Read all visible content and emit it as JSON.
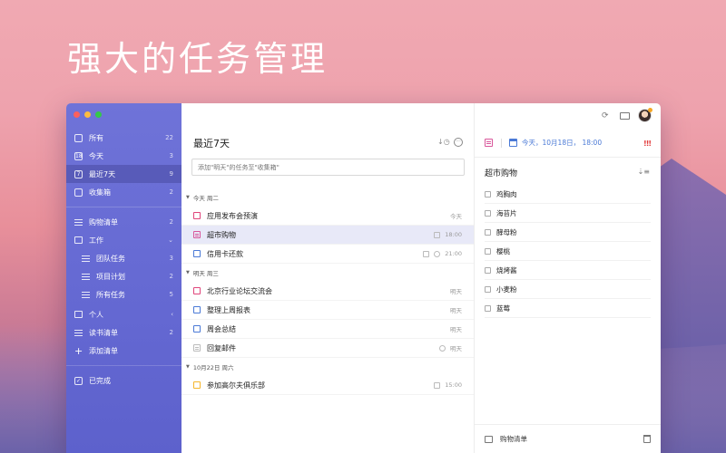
{
  "headline": "强大的任务管理",
  "sidebar": {
    "items": [
      {
        "label": "所有",
        "count": "22",
        "icon": "calendar-icon"
      },
      {
        "label": "今天",
        "count": "3",
        "icon": "today-icon"
      },
      {
        "label": "最近7天",
        "count": "9",
        "icon": "week-icon"
      },
      {
        "label": "收集箱",
        "count": "2",
        "icon": "inbox-icon"
      }
    ],
    "lists": [
      {
        "label": "购物清单",
        "count": "2",
        "icon": "list-icon"
      },
      {
        "label": "工作",
        "count": "",
        "icon": "folder-icon",
        "indicator": "⌄"
      },
      {
        "label": "团队任务",
        "count": "3",
        "icon": "list-icon",
        "sub": true
      },
      {
        "label": "项目计划",
        "count": "2",
        "icon": "list-icon",
        "sub": true
      },
      {
        "label": "所有任务",
        "count": "5",
        "icon": "list-icon",
        "sub": true
      },
      {
        "label": "个人",
        "count": "",
        "icon": "folder-icon",
        "indicator": "‹"
      },
      {
        "label": "读书清单",
        "count": "2",
        "icon": "lines-icon"
      },
      {
        "label": "添加清单",
        "count": "",
        "icon": "plus-icon"
      }
    ],
    "completed": "已完成"
  },
  "main": {
    "title": "最近7天",
    "input_placeholder": "添加\"明天\"的任务至\"收集箱\"",
    "groups": [
      {
        "header": "今天 周二",
        "tasks": [
          {
            "title": "应用发布会预演",
            "meta": "今天",
            "color": "#e0457b",
            "kind": "checkbox"
          },
          {
            "title": "超市购物",
            "meta": "18:00",
            "color": "#d9579b",
            "kind": "list",
            "selected": true,
            "has_calendar": true
          },
          {
            "title": "信用卡还款",
            "meta": "21:00",
            "color": "#4a79d6",
            "kind": "checkbox",
            "has_calendar": true,
            "has_clock": true
          }
        ]
      },
      {
        "header": "明天 周三",
        "tasks": [
          {
            "title": "北京行业论坛交流会",
            "meta": "明天",
            "color": "#e0457b",
            "kind": "checkbox"
          },
          {
            "title": "整理上周报表",
            "meta": "明天",
            "color": "#4a79d6",
            "kind": "checkbox"
          },
          {
            "title": "周会总结",
            "meta": "明天",
            "color": "#4a79d6",
            "kind": "checkbox"
          },
          {
            "title": "回复邮件",
            "meta": "明天",
            "color": "#bbbbbb",
            "kind": "list-gray",
            "has_clock": true
          }
        ]
      },
      {
        "header": "10月22日 周六",
        "tasks": [
          {
            "title": "参加高尔夫俱乐部",
            "meta": "15:00",
            "color": "#f5b52a",
            "kind": "checkbox",
            "has_calendar": true
          }
        ]
      }
    ]
  },
  "detail": {
    "date": "今天，10月18日， 18:00",
    "priority": "!!!",
    "title": "超市购物",
    "items": [
      "鸡胸肉",
      "海苔片",
      "酵母粉",
      "樱桃",
      "烧烤酱",
      "小麦粉",
      "蓝莓"
    ],
    "footer_list": "购物清单"
  },
  "colors": {
    "sidebar": "#6469d3",
    "accent_blue": "#4a79d6",
    "pink": "#d9579b",
    "priority_red": "#e23b3b"
  }
}
